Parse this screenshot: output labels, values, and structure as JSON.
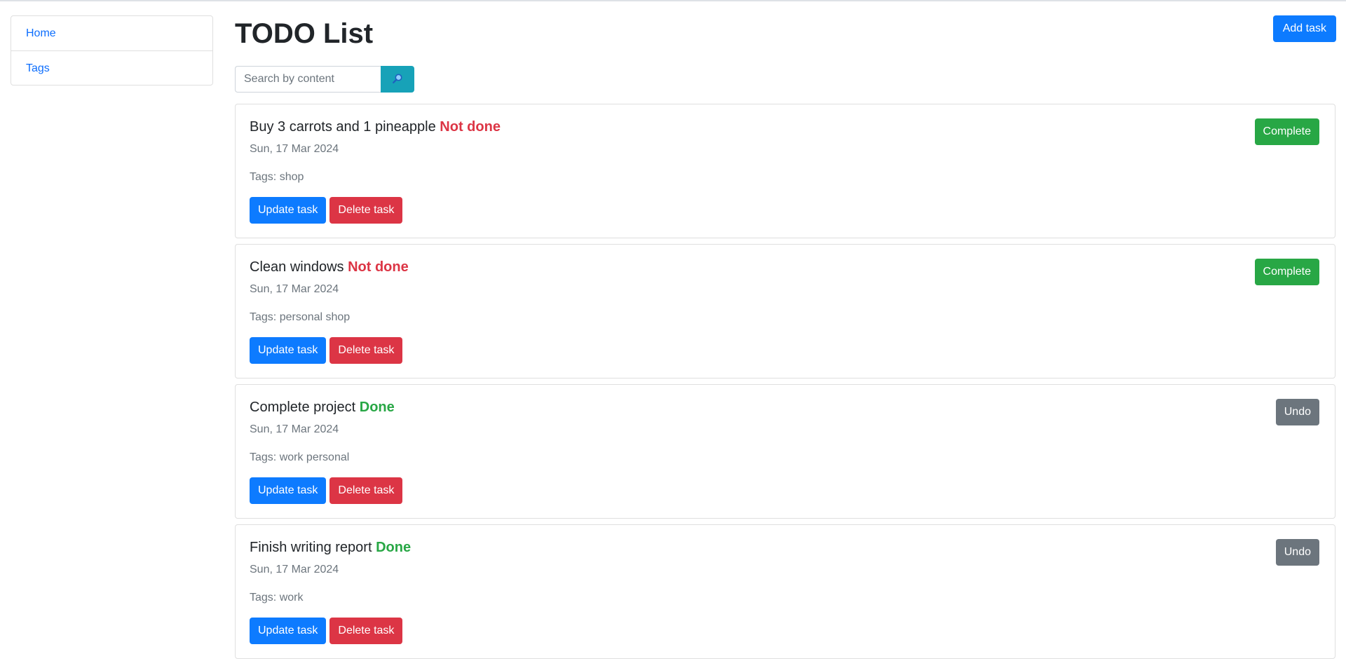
{
  "sidebar": {
    "items": [
      {
        "label": "Home"
      },
      {
        "label": "Tags"
      }
    ]
  },
  "header": {
    "title": "TODO List",
    "add_label": "Add task"
  },
  "search": {
    "placeholder": "Search by content",
    "value": "",
    "icon": "search-icon"
  },
  "tasks": [
    {
      "title": "Buy 3 carrots and 1 pineapple",
      "status": "Not done",
      "date": "Sun, 17 Mar 2024",
      "tags": "Tags: shop",
      "update_label": "Update task",
      "delete_label": "Delete task",
      "toggle_label": "Complete"
    },
    {
      "title": "Clean windows",
      "status": "Not done",
      "date": "Sun, 17 Mar 2024",
      "tags": "Tags: personal shop",
      "update_label": "Update task",
      "delete_label": "Delete task",
      "toggle_label": "Complete"
    },
    {
      "title": "Complete project",
      "status": "Done",
      "date": "Sun, 17 Mar 2024",
      "tags": "Tags: work personal",
      "update_label": "Update task",
      "delete_label": "Delete task",
      "toggle_label": "Undo"
    },
    {
      "title": "Finish writing report",
      "status": "Done",
      "date": "Sun, 17 Mar 2024",
      "tags": "Tags: work",
      "update_label": "Update task",
      "delete_label": "Delete task",
      "toggle_label": "Undo"
    }
  ],
  "colors": {
    "primary": "#0d7bff",
    "danger": "#dc3545",
    "success": "#28a745",
    "secondary": "#6c757d",
    "info": "#17a2b8"
  }
}
